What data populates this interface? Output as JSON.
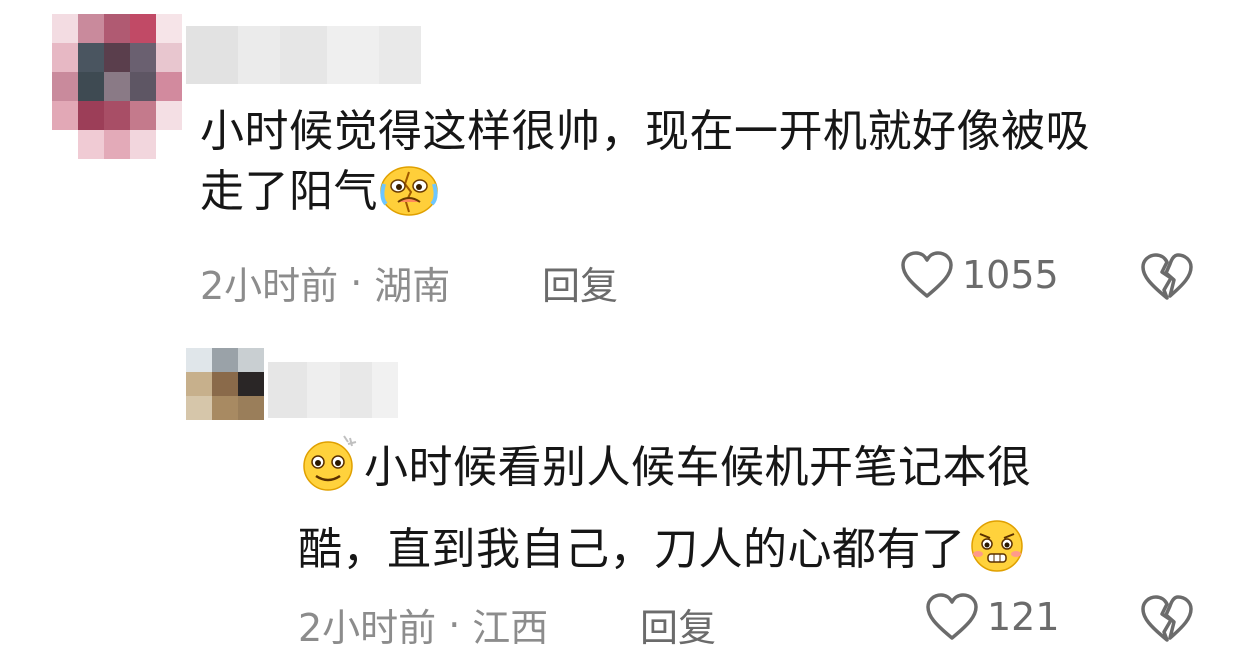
{
  "comments": [
    {
      "text_line1": "小时候觉得这样很帅，现在一开机就好像被吸",
      "text_line2": "走了阳气",
      "time": "2小时前",
      "location": "湖南",
      "reply_label": "回复",
      "like_count": "1055",
      "emoji": "crying-face-icon"
    }
  ],
  "replies": [
    {
      "text_line1": "小时候看别人候车候机开笔记本很",
      "text_line2": "酷，直到我自己，刀人的心都有了",
      "time": "2小时前",
      "location": "江西",
      "reply_label": "回复",
      "like_count": "121",
      "emoji_start": "shining-smile-icon",
      "emoji_end": "nervous-face-icon"
    }
  ],
  "colors": {
    "text": "#161616",
    "meta": "#8c8c8c",
    "icon": "#6b6b6b"
  }
}
